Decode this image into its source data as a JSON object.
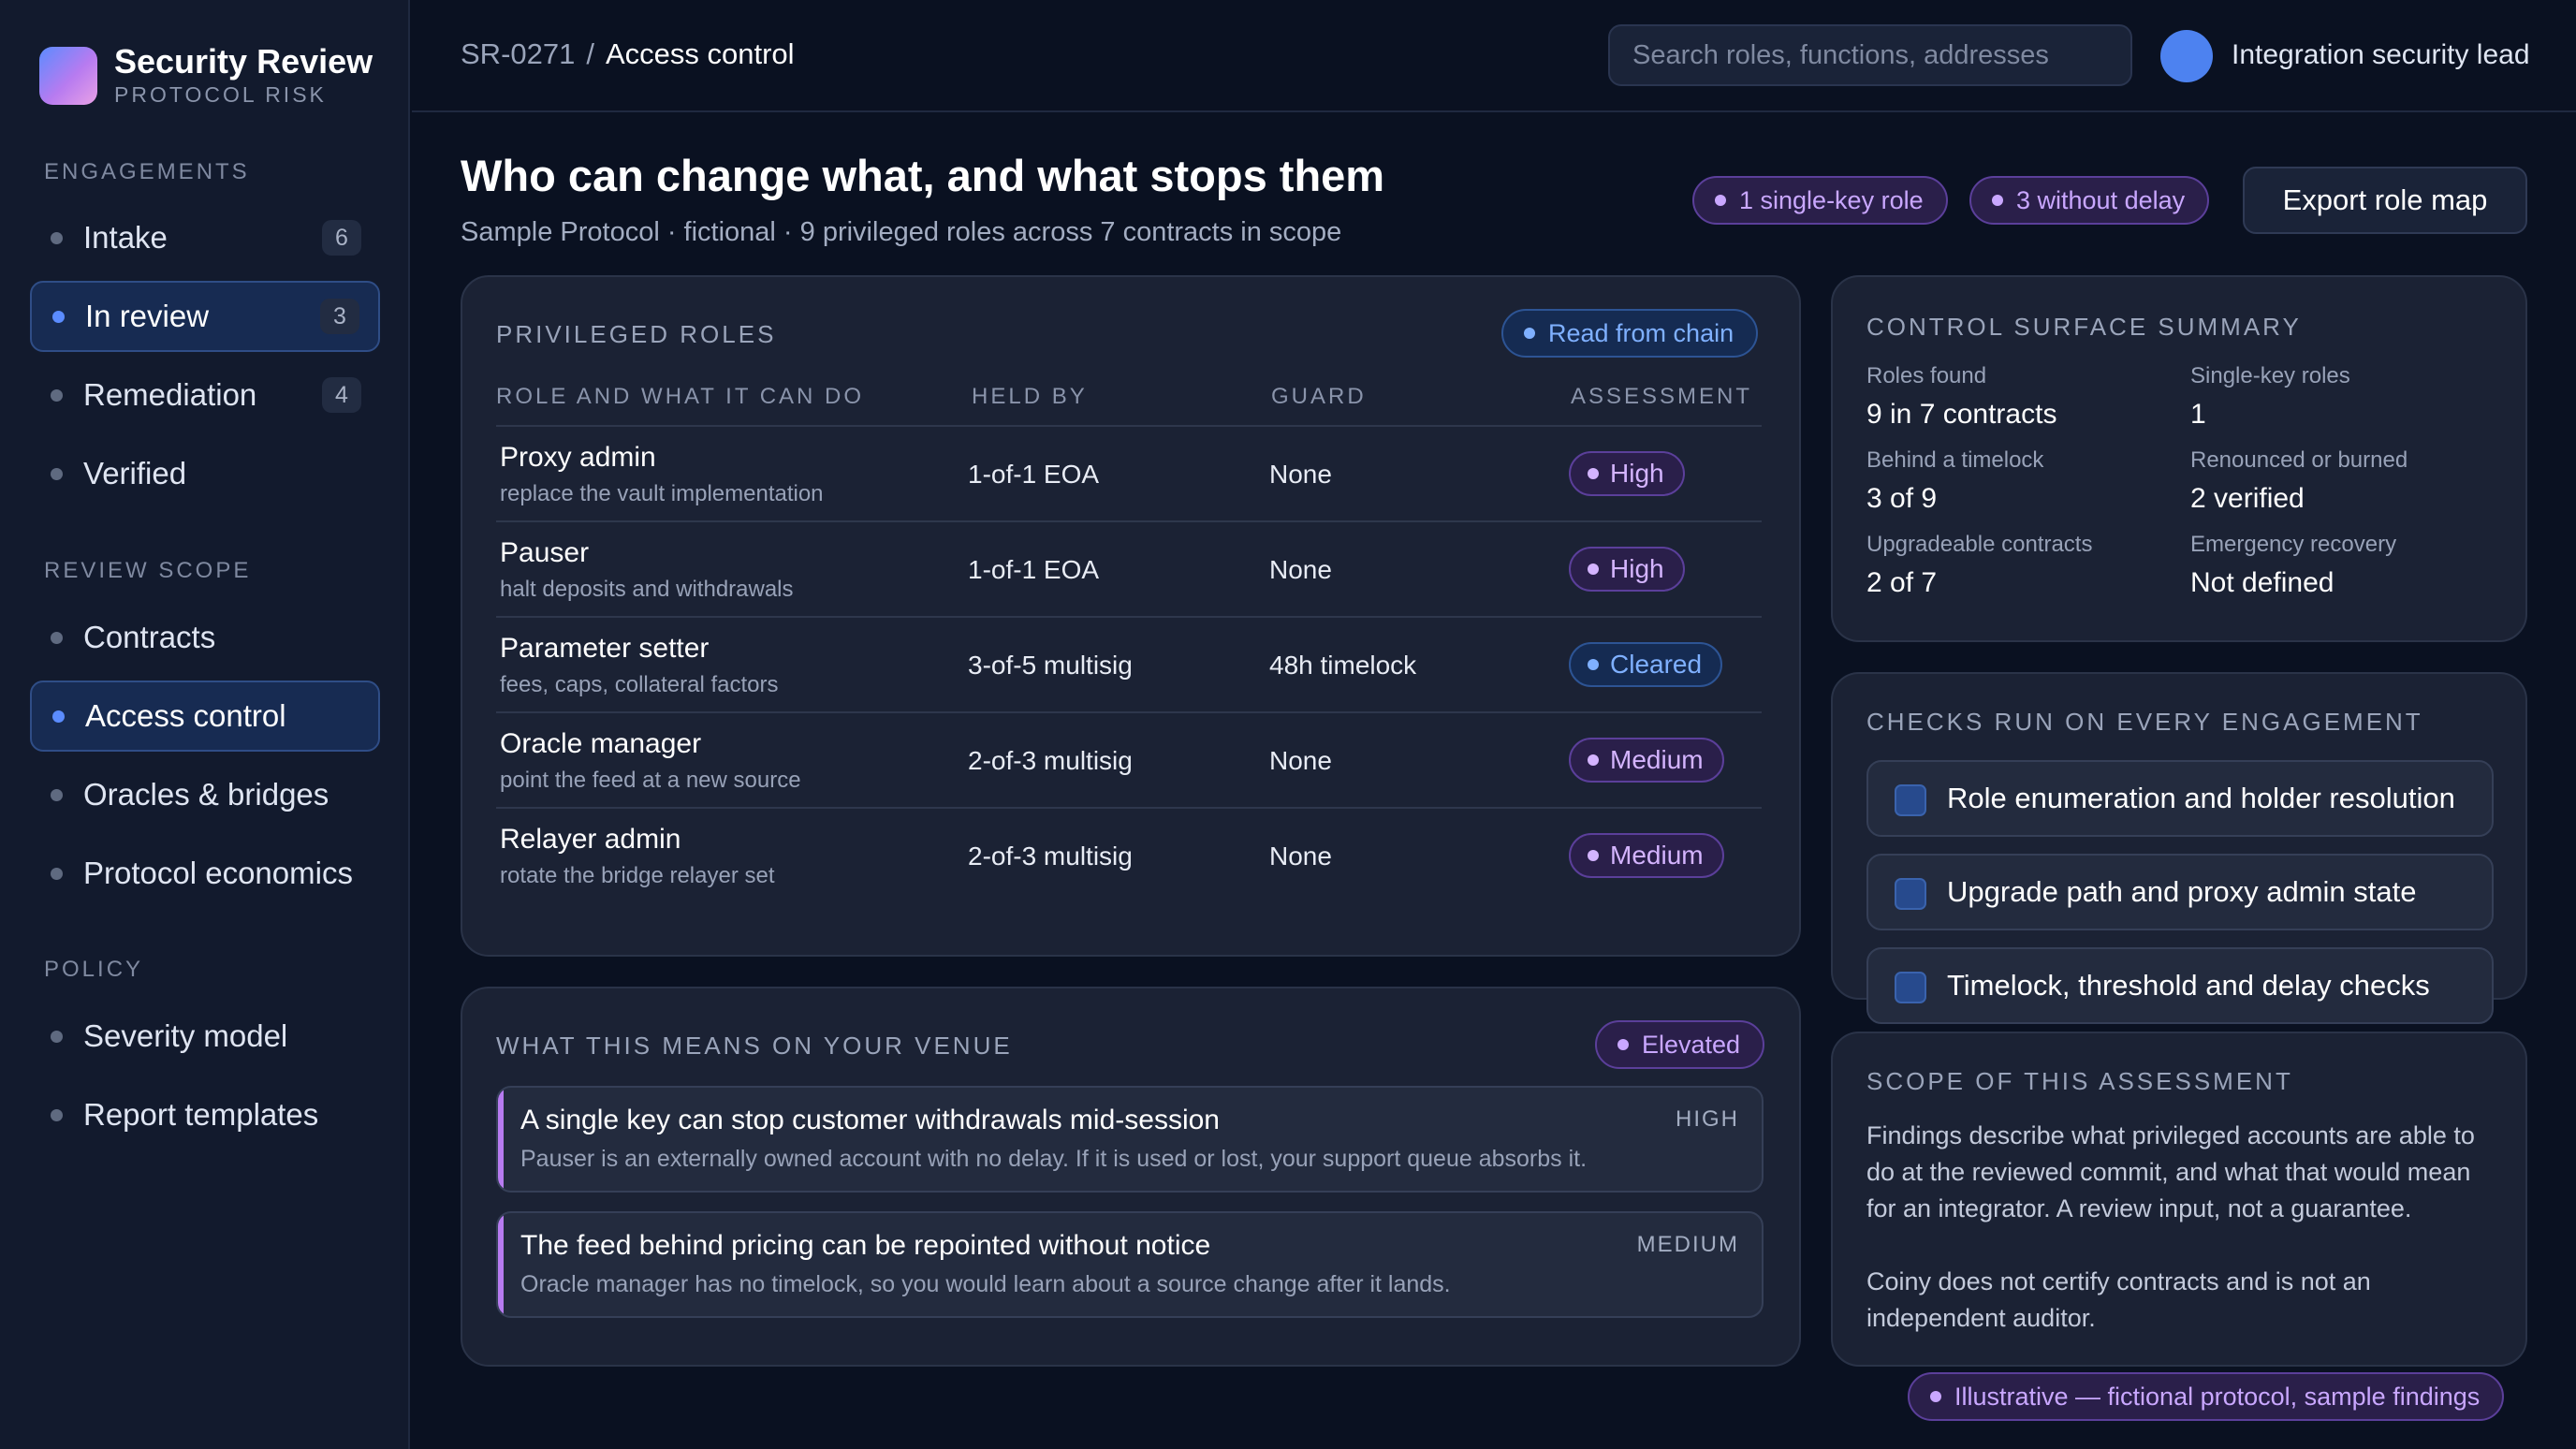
{
  "brand": {
    "title": "Security Review",
    "subtitle": "PROTOCOL RISK"
  },
  "sidebar": {
    "sections": [
      {
        "label": "ENGAGEMENTS",
        "items": [
          {
            "label": "Intake",
            "count": "6"
          },
          {
            "label": "In review",
            "count": "3",
            "active": true
          },
          {
            "label": "Remediation",
            "count": "4"
          },
          {
            "label": "Verified",
            "count": ""
          }
        ]
      },
      {
        "label": "REVIEW SCOPE",
        "items": [
          {
            "label": "Contracts"
          },
          {
            "label": "Access control",
            "active": true
          },
          {
            "label": "Oracles & bridges"
          },
          {
            "label": "Protocol economics"
          }
        ]
      },
      {
        "label": "POLICY",
        "items": [
          {
            "label": "Severity model"
          },
          {
            "label": "Report templates"
          }
        ]
      }
    ]
  },
  "header": {
    "breadcrumb": {
      "id": "SR-0271",
      "separator": "/",
      "current": "Access control"
    },
    "search_placeholder": "Search roles, functions, addresses",
    "user_role": "Integration security lead"
  },
  "page": {
    "title": "Who can change what, and what stops them",
    "subtitle": "Sample Protocol · fictional · 9 privileged roles across 7 contracts in scope",
    "chips": [
      "1 single-key role",
      "3 without delay"
    ],
    "export_label": "Export role map"
  },
  "roles_card": {
    "title": "PRIVILEGED ROLES",
    "badge": "Read from chain",
    "columns": [
      "ROLE AND WHAT IT CAN DO",
      "HELD BY",
      "GUARD",
      "ASSESSMENT"
    ],
    "rows": [
      {
        "name": "Proxy admin",
        "desc": "replace the vault implementation",
        "held_by": "1-of-1 EOA",
        "guard": "None",
        "assessment": "High"
      },
      {
        "name": "Pauser",
        "desc": "halt deposits and withdrawals",
        "held_by": "1-of-1 EOA",
        "guard": "None",
        "assessment": "High"
      },
      {
        "name": "Parameter setter",
        "desc": "fees, caps, collateral factors",
        "held_by": "3-of-5 multisig",
        "guard": "48h timelock",
        "assessment": "Cleared"
      },
      {
        "name": "Oracle manager",
        "desc": "point the feed at a new source",
        "held_by": "2-of-3 multisig",
        "guard": "None",
        "assessment": "Medium"
      },
      {
        "name": "Relayer admin",
        "desc": "rotate the bridge relayer set",
        "held_by": "2-of-3 multisig",
        "guard": "None",
        "assessment": "Medium"
      }
    ]
  },
  "impact_card": {
    "title": "WHAT THIS MEANS ON YOUR VENUE",
    "badge": "Elevated",
    "items": [
      {
        "title": "A single key can stop customer withdrawals mid-session",
        "desc": "Pauser is an externally owned account with no delay. If it is used or lost, your support queue absorbs it.",
        "severity": "HIGH"
      },
      {
        "title": "The feed behind pricing can be repointed without notice",
        "desc": "Oracle manager has no timelock, so you would learn about a source change after it lands.",
        "severity": "MEDIUM"
      }
    ]
  },
  "summary_card": {
    "title": "CONTROL SURFACE SUMMARY",
    "items": [
      {
        "label": "Roles found",
        "value": "9 in 7 contracts"
      },
      {
        "label": "Single-key roles",
        "value": "1"
      },
      {
        "label": "Behind a timelock",
        "value": "3 of 9"
      },
      {
        "label": "Renounced or burned",
        "value": "2 verified"
      },
      {
        "label": "Upgradeable contracts",
        "value": "2 of 7"
      },
      {
        "label": "Emergency recovery",
        "value": "Not defined"
      }
    ]
  },
  "checks_card": {
    "title": "CHECKS RUN ON EVERY ENGAGEMENT",
    "items": [
      "Role enumeration and holder resolution",
      "Upgrade path and proxy admin state",
      "Timelock, threshold and delay checks"
    ]
  },
  "scope_card": {
    "title": "SCOPE OF THIS ASSESSMENT",
    "para1": "Findings describe what privileged accounts are able to do at the reviewed commit, and what that would mean for an integrator. A review input, not a guarantee.",
    "para2": "Coiny does not certify contracts and is not an independent auditor."
  },
  "footer_chip": "Illustrative — fictional protocol, sample findings",
  "colors": {
    "accent": "#5b8cff",
    "severity": "#b77bf0",
    "cleared": "#7fb0ff",
    "background": "#0a1121"
  }
}
